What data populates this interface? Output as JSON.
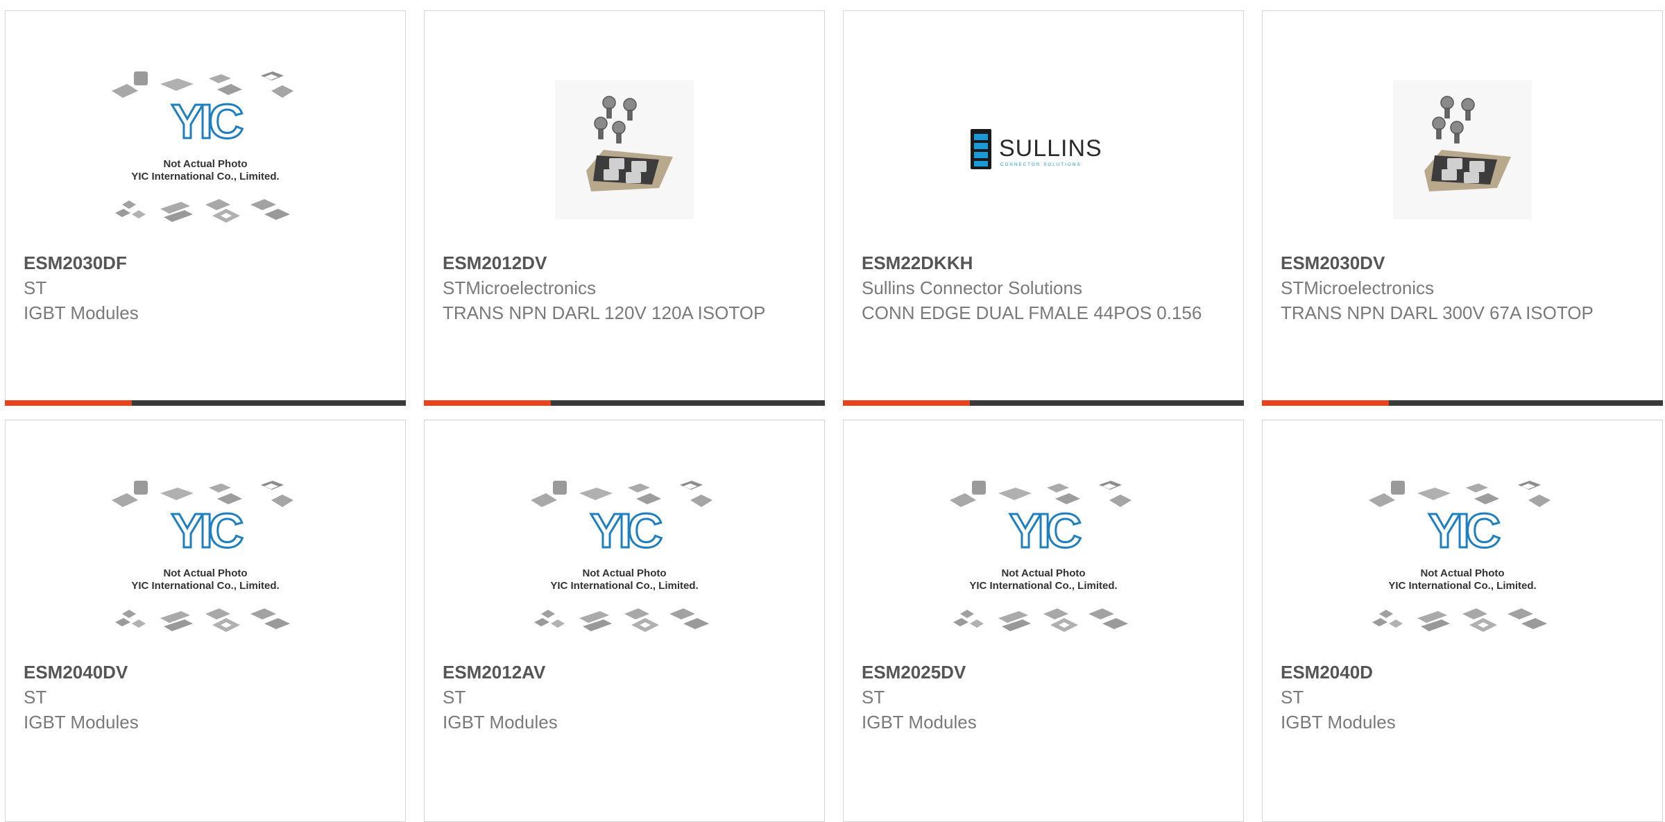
{
  "products": [
    {
      "part": "ESM2030DF",
      "manufacturer": "ST",
      "description": "IGBT Modules",
      "image": "placeholder",
      "placeholder_line1": "Not Actual Photo",
      "placeholder_line2": "YIC International Co., Limited.",
      "logo_text": "YIC"
    },
    {
      "part": "ESM2012DV",
      "manufacturer": "STMicroelectronics",
      "description": "TRANS NPN DARL 120V 120A ISOTOP",
      "image": "isotop-module"
    },
    {
      "part": "ESM22DKKH",
      "manufacturer": "Sullins Connector Solutions",
      "description": "CONN EDGE DUAL FMALE 44POS 0.156",
      "image": "sullins-logo",
      "brand_text": "SULLINS",
      "brand_subtext": "CONNECTOR SOLUTIONS"
    },
    {
      "part": "ESM2030DV",
      "manufacturer": "STMicroelectronics",
      "description": "TRANS NPN DARL 300V 67A ISOTOP",
      "image": "isotop-module"
    },
    {
      "part": "ESM2040DV",
      "manufacturer": "ST",
      "description": "IGBT Modules",
      "image": "placeholder",
      "placeholder_line1": "Not Actual Photo",
      "placeholder_line2": "YIC International Co., Limited.",
      "logo_text": "YIC"
    },
    {
      "part": "ESM2012AV",
      "manufacturer": "ST",
      "description": "IGBT Modules",
      "image": "placeholder",
      "placeholder_line1": "Not Actual Photo",
      "placeholder_line2": "YIC International Co., Limited.",
      "logo_text": "YIC"
    },
    {
      "part": "ESM2025DV",
      "manufacturer": "ST",
      "description": "IGBT Modules",
      "image": "placeholder",
      "placeholder_line1": "Not Actual Photo",
      "placeholder_line2": "YIC International Co., Limited.",
      "logo_text": "YIC"
    },
    {
      "part": "ESM2040D",
      "manufacturer": "ST",
      "description": "IGBT Modules",
      "image": "placeholder",
      "placeholder_line1": "Not Actual Photo",
      "placeholder_line2": "YIC International Co., Limited.",
      "logo_text": "YIC"
    }
  ],
  "colors": {
    "accent": "#e8431c",
    "bar_dark": "#3a3a3a",
    "title_text": "#555555",
    "body_text": "#7a7a7a",
    "yic_blue": "#1e7fc0",
    "sullins_blue": "#1a9ad6"
  }
}
